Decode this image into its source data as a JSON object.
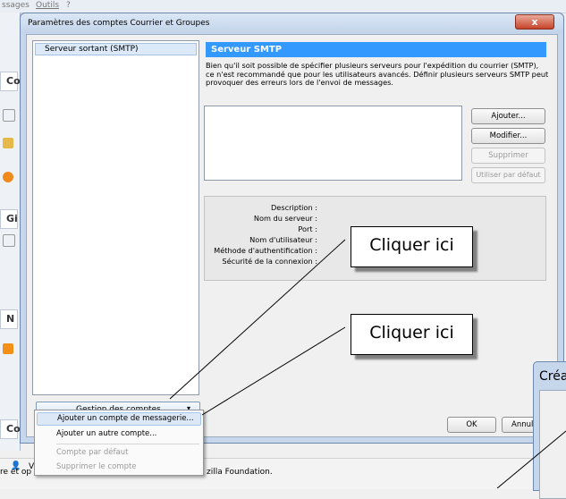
{
  "background": {
    "menu_items": [
      "ssages",
      "Outils",
      "?"
    ],
    "left_tabs": [
      "Co",
      "Gi",
      "N",
      "Co"
    ],
    "status_text_left": "re et op",
    "status_text_right": "zilla Foundation.",
    "status_icon_label": "V"
  },
  "dialog": {
    "title": "Paramètres des comptes Courrier et Groupes",
    "close_label": "x",
    "account_list": [
      "Serveur sortant (SMTP)"
    ],
    "account_button_label": "Gestion des comptes",
    "account_button_arrow": "▾",
    "smtp": {
      "header": "Serveur SMTP",
      "description": "Bien qu'il soit possible de spécifier plusieurs serveurs pour l'expédition du courrier (SMTP), ce n'est recommandé que pour les utilisateurs avancés. Définir plusieurs serveurs SMTP peut provoquer des erreurs lors de l'envoi de messages.",
      "buttons": {
        "add": "Ajouter...",
        "modify": "Modifier...",
        "delete": "Supprimer",
        "default": "Utiliser par défaut"
      },
      "details": [
        "Description :",
        "Nom du serveur :",
        "Port :",
        "Nom d'utilisateur :",
        "Méthode d'authentification :",
        "Sécurité de la connexion :"
      ]
    },
    "ok_label": "OK",
    "cancel_label": "Annuler"
  },
  "menu": {
    "items": [
      {
        "label": "Ajouter un compte de messagerie...",
        "state": "hover"
      },
      {
        "label": "Ajouter un autre compte...",
        "state": "enabled"
      },
      {
        "label": "Compte par défaut",
        "state": "disabled"
      },
      {
        "label": "Supprimer le compte",
        "state": "disabled"
      }
    ]
  },
  "callouts": [
    "Cliquer ici",
    "Cliquer ici"
  ],
  "second_dialog": {
    "title": "Créa"
  }
}
